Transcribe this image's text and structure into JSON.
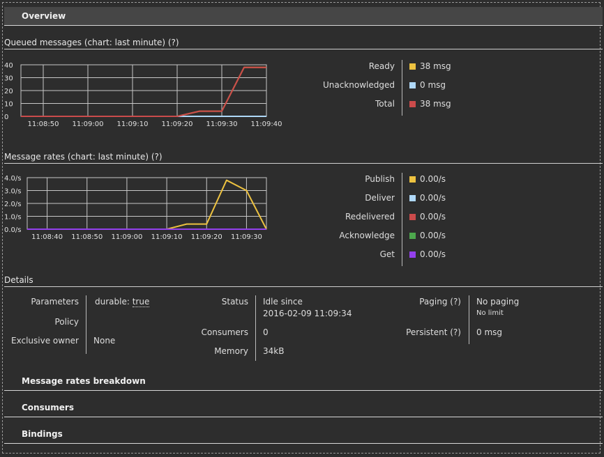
{
  "overview": {
    "title": "Overview"
  },
  "queued": {
    "title": "Queued messages (chart: last minute) (?)",
    "legend": [
      {
        "label": "Ready",
        "value": "38 msg",
        "color": "#edc240"
      },
      {
        "label": "Unacknowledged",
        "value": "0 msg",
        "color": "#afd8f8"
      },
      {
        "label": "Total",
        "value": "38 msg",
        "color": "#cb4b4b"
      }
    ]
  },
  "rates": {
    "title": "Message rates (chart: last minute) (?)",
    "legend": [
      {
        "label": "Publish",
        "value": "0.00/s",
        "color": "#edc240"
      },
      {
        "label": "Deliver",
        "value": "0.00/s",
        "color": "#afd8f8"
      },
      {
        "label": "Redelivered",
        "value": "0.00/s",
        "color": "#cb4b4b"
      },
      {
        "label": "Acknowledge",
        "value": "0.00/s",
        "color": "#4da74d"
      },
      {
        "label": "Get",
        "value": "0.00/s",
        "color": "#9440ed"
      }
    ]
  },
  "details": {
    "title": "Details",
    "parameters_label": "Parameters",
    "parameters_key": "durable:",
    "parameters_value": "true",
    "policy_label": "Policy",
    "exclusive_label": "Exclusive owner",
    "exclusive_value": "None",
    "status_label": "Status",
    "status_value": "Idle since",
    "status_time": "2016-02-09 11:09:34",
    "consumers_label": "Consumers",
    "consumers_value": "0",
    "memory_label": "Memory",
    "memory_value": "34kB",
    "paging_label": "Paging (?)",
    "paging_value": "No paging",
    "paging_sub": "No limit",
    "persistent_label": "Persistent (?)",
    "persistent_value": "0 msg"
  },
  "sections": {
    "breakdown": "Message rates breakdown",
    "consumers": "Consumers",
    "bindings": "Bindings"
  },
  "chart_data": [
    {
      "type": "line",
      "x": [
        "11:08:45",
        "11:08:50",
        "11:08:55",
        "11:09:00",
        "11:09:05",
        "11:09:10",
        "11:09:15",
        "11:09:20",
        "11:09:25",
        "11:09:30",
        "11:09:35",
        "11:09:40"
      ],
      "xticks": [
        "11:08:50",
        "11:09:00",
        "11:09:10",
        "11:09:20",
        "11:09:30",
        "11:09:40"
      ],
      "yticks": [
        "40",
        "30",
        "20",
        "10",
        "0"
      ],
      "ylim": [
        0,
        40
      ],
      "series": [
        {
          "name": "Ready",
          "color": "#edc240",
          "values": [
            0,
            0,
            0,
            0,
            0,
            0,
            0,
            0,
            4,
            4,
            38,
            38
          ]
        },
        {
          "name": "Unacknowledged",
          "color": "#afd8f8",
          "values": [
            0,
            0,
            0,
            0,
            0,
            0,
            0,
            0,
            0,
            0,
            0,
            0
          ]
        },
        {
          "name": "Total",
          "color": "#cb4b4b",
          "values": [
            0,
            0,
            0,
            0,
            0,
            0,
            0,
            0,
            4,
            4,
            38,
            38
          ]
        }
      ]
    },
    {
      "type": "line",
      "x": [
        "11:08:35",
        "11:08:40",
        "11:08:45",
        "11:08:50",
        "11:08:55",
        "11:09:00",
        "11:09:05",
        "11:09:10",
        "11:09:15",
        "11:09:20",
        "11:09:25",
        "11:09:30",
        "11:09:35"
      ],
      "xticks": [
        "11:08:40",
        "11:08:50",
        "11:09:00",
        "11:09:10",
        "11:09:20",
        "11:09:30"
      ],
      "yticks": [
        "4.0/s",
        "3.0/s",
        "2.0/s",
        "1.0/s",
        "0.0/s"
      ],
      "ylim": [
        0,
        4
      ],
      "series": [
        {
          "name": "Publish",
          "color": "#edc240",
          "values": [
            0,
            0,
            0,
            0,
            0,
            0,
            0,
            0,
            0.4,
            0.4,
            3.8,
            3.0,
            0
          ]
        },
        {
          "name": "Deliver",
          "color": "#afd8f8",
          "values": [
            0,
            0,
            0,
            0,
            0,
            0,
            0,
            0,
            0,
            0,
            0,
            0,
            0
          ]
        },
        {
          "name": "Redelivered",
          "color": "#cb4b4b",
          "values": [
            0,
            0,
            0,
            0,
            0,
            0,
            0,
            0,
            0,
            0,
            0,
            0,
            0
          ]
        },
        {
          "name": "Acknowledge",
          "color": "#4da74d",
          "values": [
            0,
            0,
            0,
            0,
            0,
            0,
            0,
            0,
            0,
            0,
            0,
            0,
            0
          ]
        },
        {
          "name": "Get",
          "color": "#9440ed",
          "values": [
            0,
            0,
            0,
            0,
            0,
            0,
            0,
            0,
            0,
            0,
            0,
            0,
            0
          ]
        }
      ]
    }
  ]
}
